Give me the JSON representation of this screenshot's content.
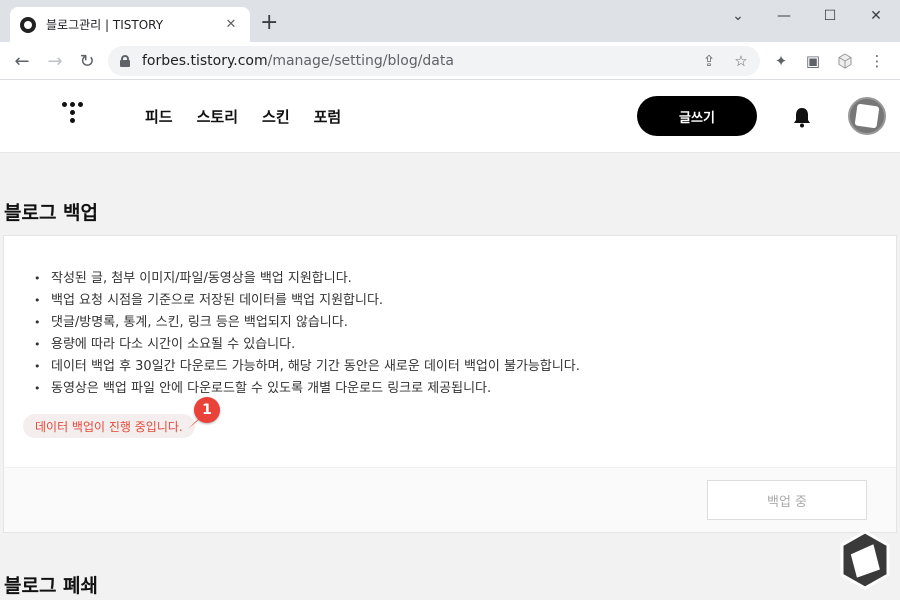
{
  "browser": {
    "tab_title": "블로그관리 | TISTORY",
    "tab_close": "✕",
    "new_tab": "+",
    "url_host": "forbes.tistory.com",
    "url_path": "/manage/setting/blog/data",
    "window_controls": [
      "⌄",
      "—",
      "☐",
      "✕"
    ]
  },
  "header": {
    "nav": [
      "피드",
      "스토리",
      "스킨",
      "포럼"
    ],
    "write_label": "글쓰기"
  },
  "backup": {
    "title": "블로그 백업",
    "notices": [
      "작성된 글, 첨부 이미지/파일/동영상을 백업 지원합니다.",
      "백업 요청 시점을 기준으로 저장된 데이터를 백업 지원합니다.",
      "댓글/방명록, 통계, 스킨, 링크 등은 백업되지 않습니다.",
      "용량에 따라 다소 시간이 소요될 수 있습니다.",
      "데이터 백업 후 30일간 다운로드 가능하며, 해당 기간 동안은 새로운 데이터 백업이 불가능합니다.",
      "동영상은 백업 파일 안에 다운로드할 수 있도록 개별 다운로드 링크로 제공됩니다."
    ],
    "status": "데이터 백업이 진행 중입니다.",
    "annotation_number": "1",
    "button_label": "백업 중"
  },
  "closure": {
    "title": "블로그 폐쇄"
  },
  "colors": {
    "accent_red": "#e8423a",
    "status_text": "#e24a3b",
    "header_button": "#000000"
  },
  "icons": {
    "back": "←",
    "forward": "→",
    "reload": "↻",
    "share": "⇪",
    "star": "☆",
    "extension": "✦",
    "sidebar": "▣",
    "more": "⋮"
  }
}
